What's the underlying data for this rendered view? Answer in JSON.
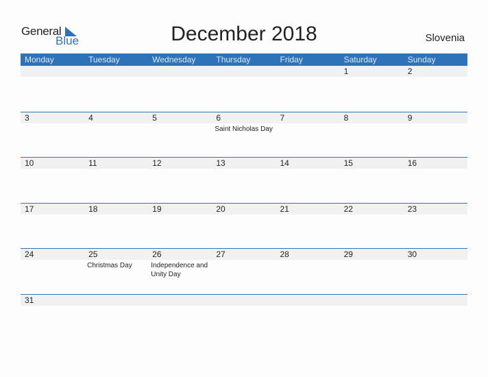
{
  "logo": {
    "general": "General",
    "blue": "Blue"
  },
  "title": "December 2018",
  "country": "Slovenia",
  "colors": {
    "accent": "#2e73b8",
    "date_strip": "#f1f1f1"
  },
  "weekdays": [
    "Monday",
    "Tuesday",
    "Wednesday",
    "Thursday",
    "Friday",
    "Saturday",
    "Sunday"
  ],
  "weeks": [
    [
      {
        "d": ""
      },
      {
        "d": ""
      },
      {
        "d": ""
      },
      {
        "d": ""
      },
      {
        "d": ""
      },
      {
        "d": "1"
      },
      {
        "d": "2"
      }
    ],
    [
      {
        "d": "3"
      },
      {
        "d": "4"
      },
      {
        "d": "5"
      },
      {
        "d": "6",
        "h": "Saint Nicholas Day"
      },
      {
        "d": "7"
      },
      {
        "d": "8"
      },
      {
        "d": "9"
      }
    ],
    [
      {
        "d": "10"
      },
      {
        "d": "11"
      },
      {
        "d": "12"
      },
      {
        "d": "13"
      },
      {
        "d": "14"
      },
      {
        "d": "15"
      },
      {
        "d": "16"
      }
    ],
    [
      {
        "d": "17"
      },
      {
        "d": "18"
      },
      {
        "d": "19"
      },
      {
        "d": "20"
      },
      {
        "d": "21"
      },
      {
        "d": "22"
      },
      {
        "d": "23"
      }
    ],
    [
      {
        "d": "24"
      },
      {
        "d": "25",
        "h": "Christmas Day"
      },
      {
        "d": "26",
        "h": "Independence and Unity Day"
      },
      {
        "d": "27"
      },
      {
        "d": "28"
      },
      {
        "d": "29"
      },
      {
        "d": "30"
      }
    ],
    [
      {
        "d": "31"
      },
      {
        "d": ""
      },
      {
        "d": ""
      },
      {
        "d": ""
      },
      {
        "d": ""
      },
      {
        "d": ""
      },
      {
        "d": ""
      }
    ]
  ]
}
